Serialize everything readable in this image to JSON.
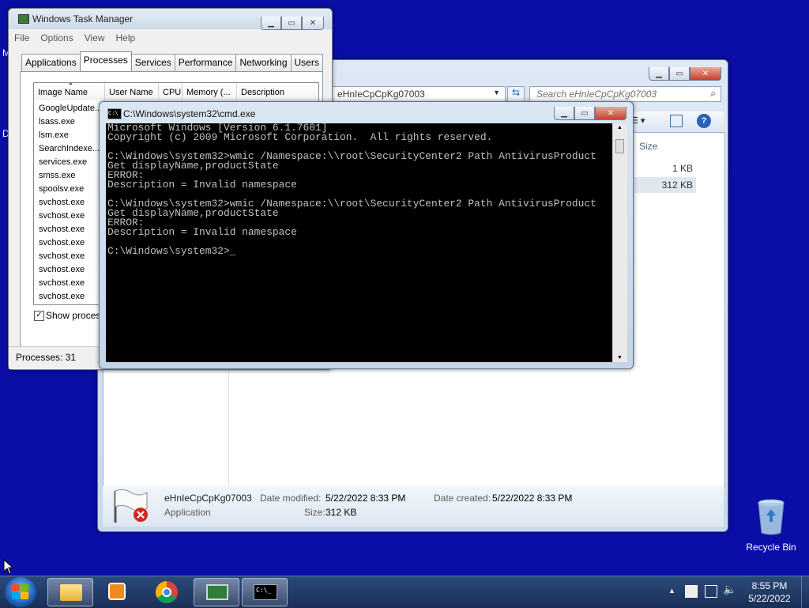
{
  "desktop": {
    "recycle_bin_label": "Recycle Bin"
  },
  "explorer": {
    "address": "eHnIeCpCpKg07003",
    "search_placeholder": "Search eHnIeCpCpKg07003",
    "column_size": "Size",
    "files": [
      {
        "size": "1 KB"
      },
      {
        "size": "312 KB"
      }
    ],
    "details": {
      "name": "eHnIeCpCpKg07003",
      "type": "Application",
      "modified_label": "Date modified:",
      "modified_value": "5/22/2022 8:33 PM",
      "created_label": "Date created:",
      "created_value": "5/22/2022 8:33 PM",
      "size_label": "Size:",
      "size_value": "312 KB"
    }
  },
  "taskmgr": {
    "title": "Windows Task Manager",
    "menu": [
      "File",
      "Options",
      "View",
      "Help"
    ],
    "tabs": [
      "Applications",
      "Processes",
      "Services",
      "Performance",
      "Networking",
      "Users"
    ],
    "active_tab": "Processes",
    "columns": [
      "Image Name",
      "User Name",
      "CPU",
      "Memory (...",
      "Description"
    ],
    "processes": [
      "GoogleUpdate...",
      "lsass.exe",
      "lsm.exe",
      "SearchIndexe...",
      "services.exe",
      "smss.exe",
      "spoolsv.exe",
      "svchost.exe",
      "svchost.exe",
      "svchost.exe",
      "svchost.exe",
      "svchost.exe",
      "svchost.exe",
      "svchost.exe",
      "svchost.exe"
    ],
    "show_processes_label": "Show processe",
    "status": "Processes: 31"
  },
  "cmd": {
    "title": "C:\\Windows\\system32\\cmd.exe",
    "lines": [
      "Microsoft Windows [Version 6.1.7601]",
      "Copyright (c) 2009 Microsoft Corporation.  All rights reserved.",
      "",
      "C:\\Windows\\system32>wmic /Namespace:\\\\root\\SecurityCenter2 Path AntivirusProduct",
      "Get displayName,productState",
      "ERROR:",
      "Description = Invalid namespace",
      "",
      "C:\\Windows\\system32>wmic /Namespace:\\\\root\\SecurityCenter2 Path AntivirusProduct",
      "Get displayName,productState",
      "ERROR:",
      "Description = Invalid namespace",
      "",
      "C:\\Windows\\system32>_"
    ]
  },
  "taskbar": {
    "time": "8:55 PM",
    "date": "5/22/2022"
  },
  "colors": {
    "desktop": "#0a0ea6",
    "console_bg": "#000000",
    "console_fg": "#c0c0c0"
  }
}
